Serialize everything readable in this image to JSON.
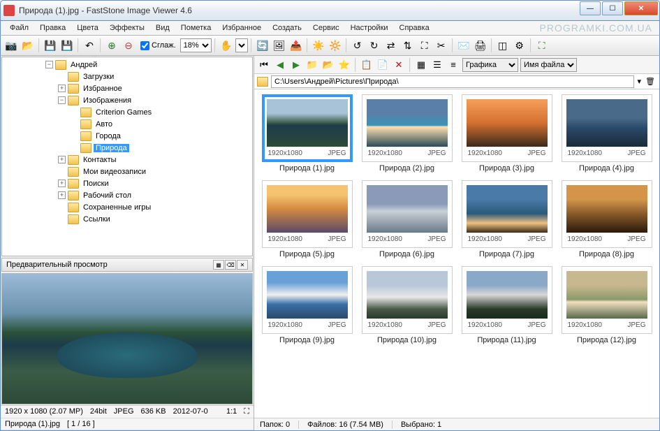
{
  "title": "Природа (1).jpg   -   FastStone Image Viewer 4.6",
  "watermark": "PROGRAMKI.COM.UA",
  "menu": [
    "Файл",
    "Правка",
    "Цвета",
    "Эффекты",
    "Вид",
    "Пометка",
    "Избранное",
    "Создать",
    "Сервис",
    "Настройки",
    "Справка"
  ],
  "toolbar": {
    "smooth_label": "Сглаж.",
    "zoom_value": "18%"
  },
  "tree": {
    "root": "Андрей",
    "items": [
      {
        "label": "Загрузки",
        "exp": ""
      },
      {
        "label": "Избранное",
        "exp": "+"
      },
      {
        "label": "Изображения",
        "exp": "-",
        "children": [
          {
            "label": "Criterion Games"
          },
          {
            "label": "Авто"
          },
          {
            "label": "Города"
          },
          {
            "label": "Природа",
            "selected": true
          }
        ]
      },
      {
        "label": "Контакты",
        "exp": "+"
      },
      {
        "label": "Мои видеозаписи",
        "exp": ""
      },
      {
        "label": "Поиски",
        "exp": "+"
      },
      {
        "label": "Рабочий стол",
        "exp": "+"
      },
      {
        "label": "Сохраненные игры",
        "exp": ""
      },
      {
        "label": "Ссылки",
        "exp": ""
      }
    ]
  },
  "preview_header": "Предварительный просмотр",
  "right_toolbar": {
    "select1": "Графика",
    "select2": "Имя файла"
  },
  "path": "C:\\Users\\Андрей\\Pictures\\Природа\\",
  "thumbs": [
    {
      "name": "Природа (1).jpg",
      "dim": "1920x1080",
      "fmt": "JPEG",
      "cls": "sc1",
      "selected": true
    },
    {
      "name": "Природа (2).jpg",
      "dim": "1920x1080",
      "fmt": "JPEG",
      "cls": "sc2"
    },
    {
      "name": "Природа (3).jpg",
      "dim": "1920x1080",
      "fmt": "JPEG",
      "cls": "sc3"
    },
    {
      "name": "Природа (4).jpg",
      "dim": "1920x1080",
      "fmt": "JPEG",
      "cls": "sc4"
    },
    {
      "name": "Природа (5).jpg",
      "dim": "1920x1080",
      "fmt": "JPEG",
      "cls": "sc5"
    },
    {
      "name": "Природа (6).jpg",
      "dim": "1920x1080",
      "fmt": "JPEG",
      "cls": "sc6"
    },
    {
      "name": "Природа (7).jpg",
      "dim": "1920x1080",
      "fmt": "JPEG",
      "cls": "sc7"
    },
    {
      "name": "Природа (8).jpg",
      "dim": "1920x1080",
      "fmt": "JPEG",
      "cls": "sc8"
    },
    {
      "name": "Природа (9).jpg",
      "dim": "1920x1080",
      "fmt": "JPEG",
      "cls": "sc9"
    },
    {
      "name": "Природа (10).jpg",
      "dim": "1920x1080",
      "fmt": "JPEG",
      "cls": "sc10"
    },
    {
      "name": "Природа (11).jpg",
      "dim": "1920x1080",
      "fmt": "JPEG",
      "cls": "sc11"
    },
    {
      "name": "Природа (12).jpg",
      "dim": "1920x1080",
      "fmt": "JPEG",
      "cls": "sc12"
    }
  ],
  "left_status": {
    "dim": "1920 x 1080 (2.07 MP)",
    "depth": "24bit",
    "fmt": "JPEG",
    "size": "636 KB",
    "date": "2012-07-0",
    "ratio": "1:1",
    "file": "Природа (1).jpg",
    "index": "[ 1 / 16 ]"
  },
  "right_status": {
    "folders": "Папок: 0",
    "files": "Файлов: 16 (7.54 MB)",
    "selected": "Выбрано: 1"
  }
}
